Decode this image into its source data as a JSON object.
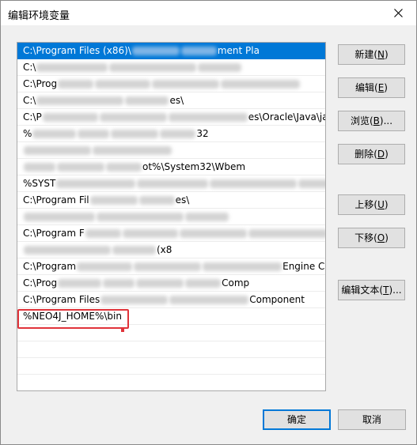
{
  "window": {
    "title": "编辑环境变量",
    "close_icon": "close-icon"
  },
  "list": {
    "rows": [
      {
        "text": "C:\\Program Files (x86)\\",
        "tail": "ment Pla",
        "state": "selected"
      },
      {
        "text": "C:\\",
        "tail": "",
        "state": "blurred"
      },
      {
        "text": "C:\\Prog",
        "tail": "",
        "state": "blurred"
      },
      {
        "text": "C:\\",
        "tail": "es\\",
        "state": "blurred"
      },
      {
        "text": "C:\\P",
        "tail": "es\\Oracle\\Java\\javapath",
        "state": "blurred"
      },
      {
        "text": "%",
        "tail": "32",
        "state": "blurred"
      },
      {
        "text": "",
        "tail": "",
        "state": "blurred"
      },
      {
        "text": "",
        "tail": "ot%\\System32\\Wbem",
        "state": "blurred"
      },
      {
        "text": "%SYST",
        "tail": "%\\System32\\WindowsPow",
        "state": "blurred"
      },
      {
        "text": "C:\\Program Fil",
        "tail": "es\\",
        "state": "blurred"
      },
      {
        "text": "",
        "tail": "",
        "state": "blurred"
      },
      {
        "text": "C:\\Program F",
        "tail": "19b\\bin",
        "state": "blurred"
      },
      {
        "text": "",
        "tail": "(x8",
        "state": "blurred"
      },
      {
        "text": "C:\\Program",
        "tail": "Engine Component",
        "state": "blurred"
      },
      {
        "text": "C:\\Prog",
        "tail": "Comp",
        "state": "blurred"
      },
      {
        "text": "C:\\Program Files",
        "tail": "Component",
        "state": "blurred"
      },
      {
        "text": "%NEO4J_HOME%\\bin",
        "tail": "",
        "state": "plain"
      },
      {
        "text": "",
        "tail": "",
        "state": "empty"
      },
      {
        "text": "",
        "tail": "",
        "state": "empty"
      },
      {
        "text": "",
        "tail": "",
        "state": "empty"
      },
      {
        "text": "",
        "tail": "",
        "state": "empty"
      }
    ]
  },
  "buttons": {
    "new": {
      "label": "新建",
      "key": "N"
    },
    "edit": {
      "label": "编辑",
      "key": "E"
    },
    "browse": {
      "label": "浏览",
      "key": "B",
      "suffix": "..."
    },
    "delete": {
      "label": "删除",
      "key": "D"
    },
    "move_up": {
      "label": "上移",
      "key": "U"
    },
    "move_down": {
      "label": "下移",
      "key": "O"
    },
    "edit_text": {
      "label": "编辑文本",
      "key": "T",
      "suffix": "..."
    },
    "ok": {
      "label": "确定"
    },
    "cancel": {
      "label": "取消"
    }
  },
  "colors": {
    "selection": "#0078d7",
    "highlight_border": "#e0333a"
  }
}
